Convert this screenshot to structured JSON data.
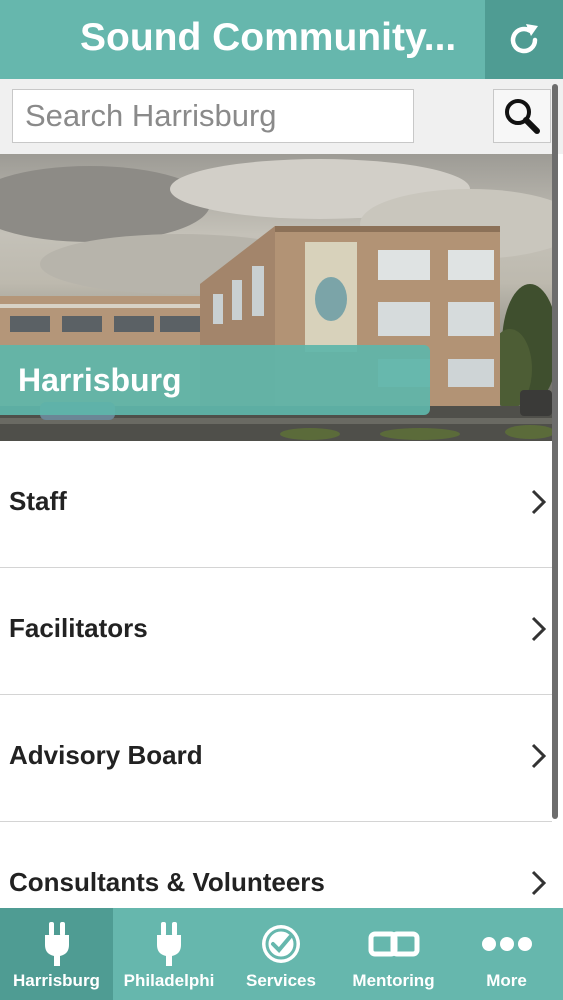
{
  "header": {
    "title": "Sound Community...",
    "refresh_icon": "refresh-icon"
  },
  "search": {
    "placeholder": "Search Harrisburg",
    "value": "",
    "search_icon": "search-icon"
  },
  "hero": {
    "label": "Harrisburg",
    "accent_color": "#5fb6aa"
  },
  "menu": {
    "items": [
      {
        "label": "Staff",
        "icon": "chevron-right-icon"
      },
      {
        "label": "Facilitators",
        "icon": "chevron-right-icon"
      },
      {
        "label": "Advisory Board",
        "icon": "chevron-right-icon"
      },
      {
        "label": "Consultants & Volunteers",
        "icon": "chevron-right-icon"
      }
    ]
  },
  "tabs": [
    {
      "label": "Harrisburg",
      "icon": "plug-icon",
      "active": true
    },
    {
      "label": "Philadelphi",
      "icon": "plug-icon",
      "active": false
    },
    {
      "label": "Services",
      "icon": "badge-check-icon",
      "active": false
    },
    {
      "label": "Mentoring",
      "icon": "chain-link-icon",
      "active": false
    },
    {
      "label": "More",
      "icon": "more-dots-icon",
      "active": false
    }
  ],
  "colors": {
    "brand": "#66b7ad",
    "brand_dark": "#4f9c93",
    "text": "#222222"
  }
}
